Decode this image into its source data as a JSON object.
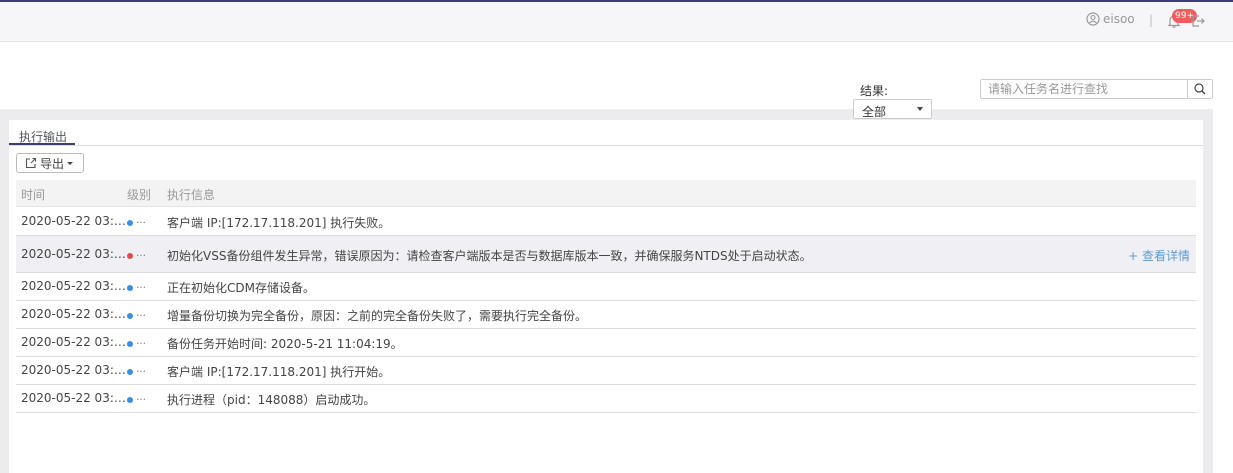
{
  "header": {
    "username": "eisoo",
    "separator": "|",
    "notification_badge": "99+"
  },
  "filter": {
    "result_label": "结果:",
    "result_value": "全部",
    "search_placeholder": "请输入任务名进行查找"
  },
  "tabs": [
    {
      "label": "执行输出",
      "active": true
    }
  ],
  "toolbar": {
    "export_label": "导出"
  },
  "table": {
    "columns": [
      "时间",
      "级别",
      "执行信息"
    ],
    "detail_link": "+ 查看详情",
    "rows": [
      {
        "time": "2020-05-22 03:…",
        "level": "info",
        "level_text": "…",
        "message": "客户端 IP:[172.17.118.201] 执行失败。"
      },
      {
        "time": "2020-05-22 03:…",
        "level": "error",
        "level_text": "…",
        "message": "初始化VSS备份组件发生异常，错误原因为：请检查客户端版本是否与数据库版本一致，并确保服务NTDS处于启动状态。",
        "has_detail": true
      },
      {
        "time": "2020-05-22 03:…",
        "level": "info",
        "level_text": "…",
        "message": "正在初始化CDM存储设备。"
      },
      {
        "time": "2020-05-22 03:…",
        "level": "info",
        "level_text": "…",
        "message": "增量备份切换为完全备份，原因：之前的完全备份失败了，需要执行完全备份。"
      },
      {
        "time": "2020-05-22 03:…",
        "level": "info",
        "level_text": "…",
        "message": "备份任务开始时间: 2020-5-21 11:04:19。"
      },
      {
        "time": "2020-05-22 03:…",
        "level": "info",
        "level_text": "…",
        "message": "客户端 IP:[172.17.118.201] 执行开始。"
      },
      {
        "time": "2020-05-22 03:…",
        "level": "info",
        "level_text": "…",
        "message": "执行进程（pid：148088）启动成功。"
      }
    ]
  },
  "colors": {
    "info": "#3a8ee6",
    "error": "#e24b4b",
    "accent": "#3b3e6e",
    "link": "#5b9bd5"
  },
  "icons": [
    "user-icon",
    "bell-icon",
    "logout-icon",
    "search-icon",
    "export-icon"
  ]
}
